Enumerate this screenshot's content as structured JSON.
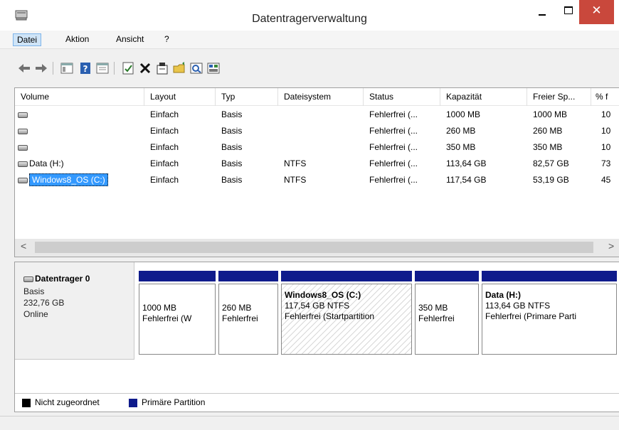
{
  "window": {
    "title": "Datentragerverwaltung",
    "close_glyph": "✕"
  },
  "menu": [
    "Datei",
    "Aktion",
    "Ansicht",
    "?"
  ],
  "toolbar_icons": [
    "back-arrow-icon",
    "forward-arrow-icon",
    "console-tree-icon",
    "help-icon",
    "properties-list-icon",
    "connect-icon",
    "delete-icon",
    "properties-icon",
    "open-icon",
    "explore-icon",
    "disk-icon"
  ],
  "columns": [
    "Volume",
    "Layout",
    "Typ",
    "Dateisystem",
    "Status",
    "Kapazität",
    "Freier Sp...",
    "% f"
  ],
  "volumes": [
    {
      "name": "",
      "layout": "Einfach",
      "type": "Basis",
      "fs": "",
      "status": "Fehlerfrei (...",
      "capacity": "1000 MB",
      "free": "1000 MB",
      "pct": "10"
    },
    {
      "name": "",
      "layout": "Einfach",
      "type": "Basis",
      "fs": "",
      "status": "Fehlerfrei (...",
      "capacity": "260 MB",
      "free": "260 MB",
      "pct": "10"
    },
    {
      "name": "",
      "layout": "Einfach",
      "type": "Basis",
      "fs": "",
      "status": "Fehlerfrei (...",
      "capacity": "350 MB",
      "free": "350 MB",
      "pct": "10"
    },
    {
      "name": "Data (H:)",
      "layout": "Einfach",
      "type": "Basis",
      "fs": "NTFS",
      "status": "Fehlerfrei (...",
      "capacity": "113,64 GB",
      "free": "82,57 GB",
      "pct": "73"
    },
    {
      "name": "Windows8_OS (C:)",
      "layout": "Einfach",
      "type": "Basis",
      "fs": "NTFS",
      "status": "Fehlerfrei (...",
      "capacity": "117,54 GB",
      "free": "53,19 GB",
      "pct": "45"
    }
  ],
  "scroll": {
    "left": "<",
    "right": ">"
  },
  "disk": {
    "title": "Datentrager 0",
    "type": "Basis",
    "size": "232,76 GB",
    "state": "Online"
  },
  "partitions": [
    {
      "name": "",
      "size": "1000 MB",
      "status": "Fehlerfrei (W"
    },
    {
      "name": "",
      "size": "260 MB",
      "status": "Fehlerfrei"
    },
    {
      "name": "Windows8_OS (C:)",
      "size": "117,54 GB NTFS",
      "status": "Fehlerfrei (Startpartition"
    },
    {
      "name": "",
      "size": "350 MB",
      "status": "Fehlerfrei"
    },
    {
      "name": "Data (H:)",
      "size": "113,64 GB NTFS",
      "status": "Fehlerfrei (Primare Parti"
    }
  ],
  "legend": [
    {
      "label": "Nicht zugeordnet",
      "color": "#000000"
    },
    {
      "label": "Primäre Partition",
      "color": "#0f1b8c"
    }
  ]
}
